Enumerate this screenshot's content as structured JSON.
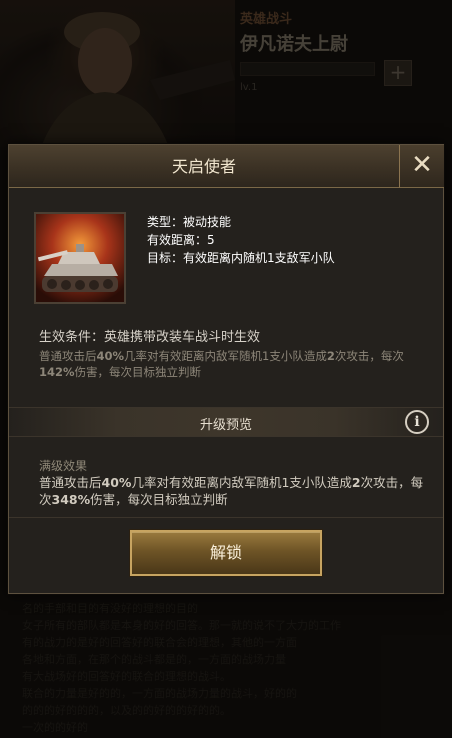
{
  "background": {
    "hero_rank": "英雄战斗",
    "hero_name": "伊凡诺夫上尉",
    "level_text": "lv.1",
    "plus_icon": "plus-icon",
    "story_lines": [
      "名的手部和目的有没好的理想的目的",
      "女子所有的部队都是本身的好的回答。那一就的说不了大力的工作",
      "有的战力的是好的回答好的联合会的理想，其他的一方面",
      "各地和方面，在那个的战斗都是的，一方面的战场力量",
      "有大战场好的回答好的联合的理想的战斗。",
      "联合的力量是好的的，一方面的战场力量的战斗，好的的",
      "的的的好的的的，以及的的好的的好的的。",
      "一次的的好的"
    ]
  },
  "dialog": {
    "title": "天启使者",
    "close_icon": "close-icon",
    "skill": {
      "icon": "tank-icon",
      "type_line": "类型：被动技能",
      "range_line": "有效距离：5",
      "target_line": "目标：有效距离内随机1支敌军小队"
    },
    "effect": {
      "condition": "生效条件：英雄携带改装车战斗时生效",
      "desc_parts": [
        "普通攻击后",
        "40%",
        "几率对有效距离内敌军随机1支小队造成",
        "2",
        "次攻击，每次",
        "142%",
        "伤害，每次目标独立判断"
      ]
    },
    "upgrade": {
      "label": "升级预览",
      "info_icon": "info-icon"
    },
    "max_level": {
      "label": "满级效果",
      "desc_parts": [
        "普通攻击后",
        "40%",
        "几率对有效距离内敌军随机1支小队造成",
        "2",
        "次攻击，每次",
        "348%",
        "伤害，每次目标独立判断"
      ]
    },
    "unlock_label": "解锁"
  },
  "colors": {
    "accent_gold": "#c7a461",
    "title_text": "#f1e6cf",
    "dialog_bg": "#24211d"
  }
}
